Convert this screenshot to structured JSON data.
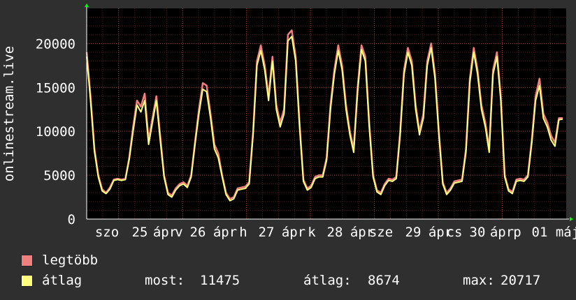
{
  "chart_data": {
    "type": "line",
    "ylabel": "onlinestream.live",
    "ylim": [
      0,
      24000
    ],
    "yticks": [
      0,
      5000,
      10000,
      15000,
      20000
    ],
    "grid": true,
    "x_tick_labels": [
      "szo",
      "25",
      "ápr",
      "v",
      "26",
      "ápr",
      "h",
      "27",
      "ápr",
      "k",
      "28",
      "ápr",
      "sze",
      "29",
      "ápr",
      "cs",
      "30",
      "ápr",
      "p",
      "01",
      "máj"
    ],
    "x_day_ticks": [
      "25",
      "26",
      "27",
      "28",
      "29",
      "30",
      "01"
    ],
    "x_days": 7.5,
    "colors": {
      "max": "#f08080",
      "avg": "#ffff80",
      "axis": "#ffffff",
      "grid": "#c04040",
      "bg": "#000000",
      "arrow": "#00ff00"
    },
    "series": [
      {
        "name": "legtöbb",
        "values": [
          19000,
          14000,
          8000,
          5000,
          3400,
          3000,
          3600,
          4500,
          4600,
          4500,
          4600,
          7000,
          10500,
          13500,
          12800,
          14300,
          9000,
          11500,
          14000,
          9500,
          5000,
          3000,
          2700,
          3500,
          4000,
          4200,
          3800,
          5000,
          8800,
          12500,
          15500,
          15200,
          12000,
          8500,
          7500,
          5000,
          3000,
          2300,
          2500,
          3500,
          3600,
          3700,
          4200,
          10000,
          18000,
          19800,
          17500,
          14000,
          18500,
          13000,
          11000,
          12500,
          21000,
          21500,
          18500,
          11000,
          4500,
          3500,
          3800,
          4800,
          5000,
          5000,
          7000,
          13000,
          17000,
          19800,
          17500,
          13000,
          10000,
          8000,
          15000,
          19800,
          18500,
          11000,
          5000,
          3300,
          3000,
          4000,
          4600,
          4500,
          4800,
          10000,
          17000,
          19500,
          18000,
          13000,
          10000,
          12000,
          18000,
          20000,
          16500,
          10000,
          4200,
          3000,
          3500,
          4300,
          4400,
          4500,
          8000,
          16000,
          19500,
          17000,
          13000,
          11000,
          8000,
          17000,
          19000,
          14000,
          5000,
          3400,
          3100,
          4500,
          4600,
          4500,
          5000,
          9000,
          14000,
          16000,
          12000,
          11000,
          9500,
          8700,
          11500,
          11500
        ]
      },
      {
        "name": "átlag",
        "values": [
          18500,
          13500,
          7700,
          4800,
          3200,
          2900,
          3400,
          4400,
          4500,
          4400,
          4500,
          6800,
          10000,
          13000,
          12200,
          13500,
          8500,
          11000,
          13500,
          9000,
          4800,
          2800,
          2500,
          3300,
          3800,
          4000,
          3600,
          4800,
          8500,
          12000,
          14800,
          14500,
          11500,
          8000,
          7000,
          4800,
          2800,
          2100,
          2300,
          3300,
          3400,
          3500,
          4000,
          9600,
          17500,
          19200,
          17000,
          13500,
          18000,
          12500,
          10500,
          12000,
          20300,
          20800,
          18000,
          10500,
          4300,
          3300,
          3600,
          4600,
          4800,
          4800,
          6700,
          12500,
          16500,
          19200,
          17000,
          12500,
          9600,
          7600,
          14500,
          19300,
          18000,
          10500,
          4800,
          3100,
          2800,
          3800,
          4400,
          4300,
          4600,
          9600,
          16500,
          19000,
          17500,
          12500,
          9600,
          11500,
          17500,
          19500,
          16000,
          9600,
          4000,
          2800,
          3300,
          4100,
          4200,
          4300,
          7600,
          15500,
          19000,
          16500,
          12500,
          10500,
          7600,
          16500,
          18500,
          13500,
          4800,
          3200,
          2900,
          4300,
          4400,
          4300,
          4800,
          8600,
          13500,
          15200,
          11500,
          10500,
          9000,
          8300,
          11300,
          11400
        ]
      }
    ],
    "legend": [
      {
        "label": "legtöbb",
        "color": "#f08080"
      },
      {
        "label": "átlag",
        "color": "#ffff80"
      }
    ],
    "stats": {
      "most_label": "most:",
      "most_value": "11475",
      "atlag_label": "átlag:",
      "atlag_value": "8674",
      "max_label": "max:",
      "max_value": "20717"
    }
  }
}
